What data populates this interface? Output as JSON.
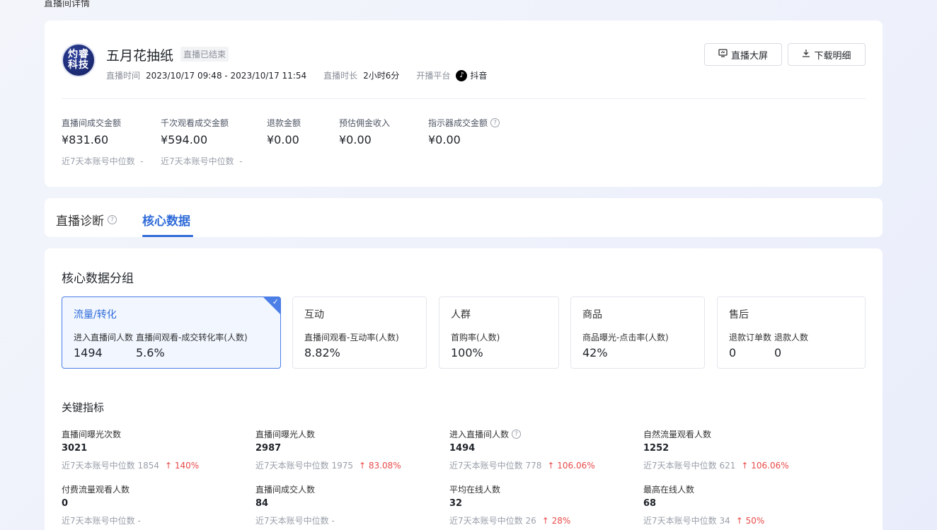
{
  "page_title": "直播间详情",
  "room": {
    "avatar_text": "灼睿科技",
    "name": "五月花抽纸",
    "status": "直播已结束",
    "time_label": "直播时间",
    "time_value": "2023/10/17 09:48 - 2023/10/17 11:54",
    "duration_label": "直播时长",
    "duration_value": "2小时6分",
    "platform_label": "开播平台",
    "platform_value": "抖音"
  },
  "actions": {
    "screen_label": "直播大屏",
    "download_label": "下载明细"
  },
  "summary_metrics": [
    {
      "label": "直播间成交金额",
      "value": "¥831.60",
      "sub_label": "近7天本账号中位数",
      "sub_value": "-"
    },
    {
      "label": "千次观看成交金额",
      "value": "¥594.00",
      "sub_label": "近7天本账号中位数",
      "sub_value": "-"
    },
    {
      "label": "退款金额",
      "value": "¥0.00"
    },
    {
      "label": "预估佣金收入",
      "value": "¥0.00"
    },
    {
      "label": "指示器成交金额",
      "value": "¥0.00"
    }
  ],
  "tabs": [
    {
      "label": "直播诊断"
    },
    {
      "label": "核心数据"
    }
  ],
  "core": {
    "title": "核心数据分组",
    "groups": [
      {
        "title": "流量/转化",
        "labels": [
          "进入直播间人数",
          "直播间观看-成交转化率(人数)"
        ],
        "values": [
          "1494",
          "5.6%"
        ]
      },
      {
        "title": "互动",
        "labels": [
          "直播间观看-互动率(人数)"
        ],
        "values": [
          "8.82%"
        ]
      },
      {
        "title": "人群",
        "labels": [
          "首购率(人数)"
        ],
        "values": [
          "100%"
        ]
      },
      {
        "title": "商品",
        "labels": [
          "商品曝光-点击率(人数)"
        ],
        "values": [
          "42%"
        ]
      },
      {
        "title": "售后",
        "labels": [
          "退款订单数",
          "退款人数"
        ],
        "values": [
          "0",
          "0"
        ]
      }
    ],
    "kpi_title": "关键指标",
    "kpis": [
      {
        "label": "直播间曝光次数",
        "value": "3021",
        "sub": "近7天本账号中位数 1854",
        "change": "↑ 140%"
      },
      {
        "label": "直播间曝光人数",
        "value": "2987",
        "sub": "近7天本账号中位数 1975",
        "change": "↑ 83.08%"
      },
      {
        "label": "进入直播间人数",
        "value": "1494",
        "sub": "近7天本账号中位数 778",
        "change": "↑ 106.06%"
      },
      {
        "label": "自然流量观看人数",
        "value": "1252",
        "sub": "近7天本账号中位数 621",
        "change": "↑ 106.06%"
      },
      {
        "label": "付费流量观看人数",
        "value": "0",
        "sub": "近7天本账号中位数 -",
        "change": ""
      },
      {
        "label": "直播间成交人数",
        "value": "84",
        "sub": "近7天本账号中位数 -",
        "change": ""
      },
      {
        "label": "平均在线人数",
        "value": "32",
        "sub": "近7天本账号中位数 26",
        "change": "↑ 28%"
      },
      {
        "label": "最高在线人数",
        "value": "68",
        "sub": "近7天本账号中位数 34",
        "change": "↑ 50%"
      }
    ]
  }
}
